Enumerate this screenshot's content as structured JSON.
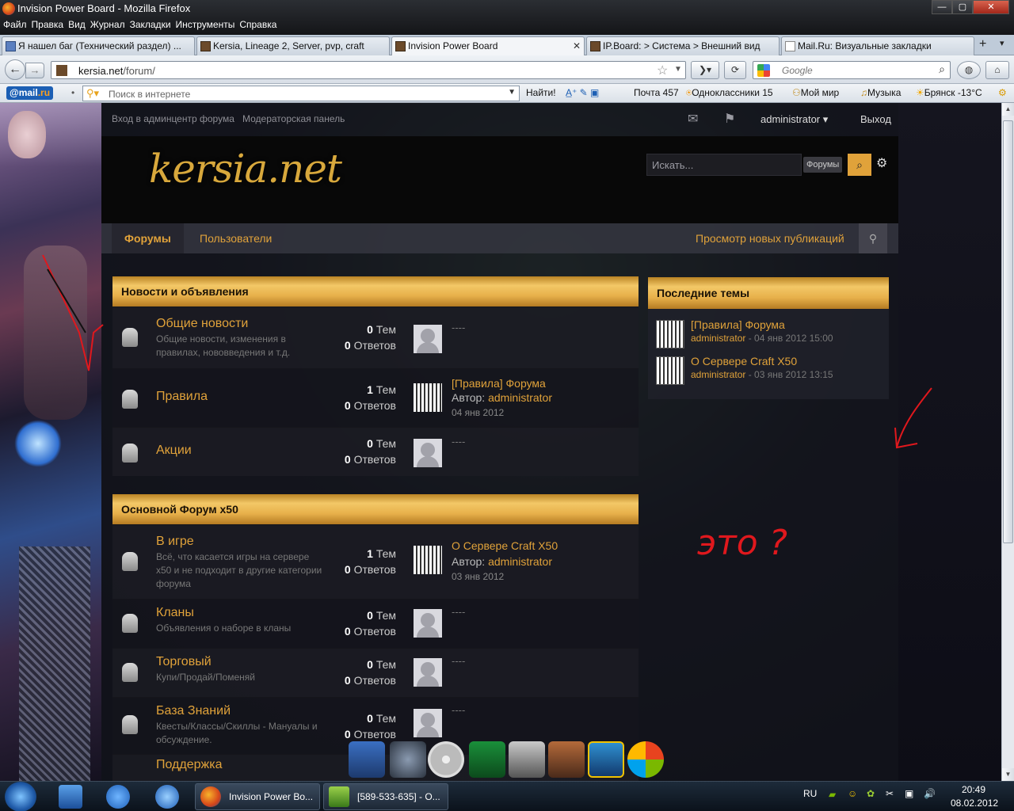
{
  "window": {
    "title": "Invision Power Board - Mozilla Firefox",
    "menu": [
      "Файл",
      "Правка",
      "Вид",
      "Журнал",
      "Закладки",
      "Инструменты",
      "Справка"
    ],
    "controls": {
      "minimize": "—",
      "maximize": "▢",
      "close": "✕"
    }
  },
  "tabs": [
    {
      "label": "Я нашел баг (Технический раздел) ...",
      "active": false
    },
    {
      "label": "Kersia, Lineage 2, Server, pvp, craft",
      "active": false
    },
    {
      "label": "Invision Power Board",
      "active": true
    },
    {
      "label": "IP.Board: > Система > Внешний вид",
      "active": false
    },
    {
      "label": "Mail.Ru: Визуальные закладки",
      "active": false
    }
  ],
  "tab_new": "+",
  "nav": {
    "url_host": "kersia.net",
    "url_path": "/forum/",
    "search_placeholder": "Google"
  },
  "mailru": {
    "logo_at": "@mail",
    "logo_ru": ".ru",
    "search_placeholder": "Поиск в интернете",
    "find": "Найти!",
    "mail": "Почта 457",
    "ok": "Одноклассники 15",
    "myworld": "Мой мир",
    "music": "Музыка",
    "weather": "Брянск -13°C"
  },
  "forum": {
    "top_links": [
      "Вход в админцентр форума",
      "Модераторская панель"
    ],
    "username": "administrator",
    "logout": "Выход",
    "logo": "kersia.net",
    "search_placeholder": "Искать...",
    "search_scope": "Форумы",
    "nav_tabs": [
      "Форумы",
      "Пользователи"
    ],
    "new_posts": "Просмотр новых публикаций",
    "categories": [
      {
        "title": "Новости и объявления",
        "forums": [
          {
            "name": "Общие новости",
            "desc": "Общие новости, изменения в правилах, нововведения и т.д.",
            "topics": "0",
            "replies": "0",
            "topics_label": "Тем",
            "replies_label": "Ответов",
            "last": "----"
          },
          {
            "name": "Правила",
            "desc": "",
            "topics": "1",
            "replies": "0",
            "topics_label": "Тем",
            "replies_label": "Ответов",
            "last_title": "[Правила] Форума",
            "last_author_label": "Автор:",
            "last_author": "administrator",
            "last_date": "04 янв 2012"
          },
          {
            "name": "Акции",
            "desc": "",
            "topics": "0",
            "replies": "0",
            "topics_label": "Тем",
            "replies_label": "Ответов",
            "last": "----"
          }
        ]
      },
      {
        "title": "Основной Форум x50",
        "forums": [
          {
            "name": "В игре",
            "desc": "Всё, что касается игры на сервере x50 и не подходит в другие категории форума",
            "topics": "1",
            "replies": "0",
            "topics_label": "Тем",
            "replies_label": "Ответов",
            "last_title": "О Сервере Craft X50",
            "last_author_label": "Автор:",
            "last_author": "administrator",
            "last_date": "03 янв 2012"
          },
          {
            "name": "Кланы",
            "desc": "Объявления о наборе в кланы",
            "topics": "0",
            "replies": "0",
            "topics_label": "Тем",
            "replies_label": "Ответов",
            "last": "----"
          },
          {
            "name": "Торговый",
            "desc": "Купи/Продай/Поменяй",
            "topics": "0",
            "replies": "0",
            "topics_label": "Тем",
            "replies_label": "Ответов",
            "last": "----"
          },
          {
            "name": "База Знаний",
            "desc": "Квесты/Классы/Скиллы - Мануалы и обсуждение.",
            "topics": "0",
            "replies": "0",
            "topics_label": "Тем",
            "replies_label": "Ответов",
            "last": "----"
          },
          {
            "name": "Поддержка",
            "desc": "",
            "topics": "",
            "replies": "",
            "topics_label": "",
            "replies_label": "",
            "last": ""
          }
        ]
      }
    ],
    "sidebar": {
      "title": "Последние темы",
      "items": [
        {
          "title": "[Правила] Форума",
          "author": "administrator",
          "date": "- 04 янв 2012 15:00"
        },
        {
          "title": "О Сервере Craft X50",
          "author": "administrator",
          "date": "- 03 янв 2012 13:15"
        }
      ]
    },
    "annotation": "это ?"
  },
  "taskbar": {
    "items": [
      "Invision Power Bo...",
      "[589-533-635] - О..."
    ],
    "lang": "RU",
    "time": "20:49",
    "date": "08.02.2012"
  }
}
